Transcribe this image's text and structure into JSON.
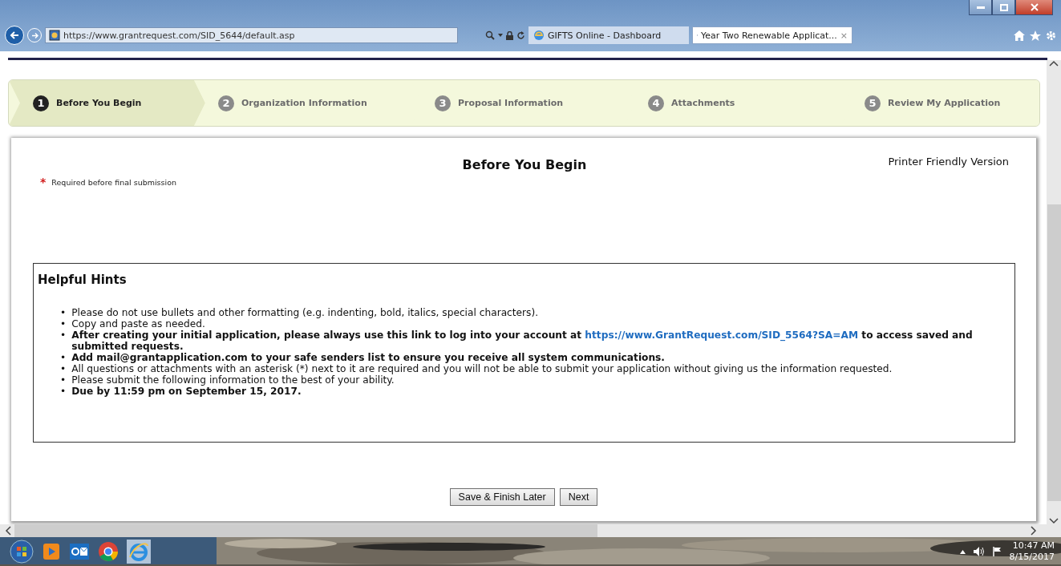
{
  "browser": {
    "address": "https://www.grantrequest.com/SID_5644/default.asp",
    "tabs": [
      {
        "label": "GIFTS Online - Dashboard",
        "selected": false
      },
      {
        "label": "Year Two Renewable Applicat...",
        "selected": true,
        "close_glyph": "×"
      }
    ]
  },
  "steps": [
    {
      "number": "1",
      "label": "Before You Begin",
      "selected": true
    },
    {
      "number": "2",
      "label": "Organization Information",
      "selected": false
    },
    {
      "number": "3",
      "label": "Proposal Information",
      "selected": false
    },
    {
      "number": "4",
      "label": "Attachments",
      "selected": false
    },
    {
      "number": "5",
      "label": "Review My Application",
      "selected": false
    }
  ],
  "page": {
    "title": "Before You Begin",
    "printer_link": "Printer Friendly Version",
    "required_mark": "*",
    "required_note": "Required before final submission"
  },
  "hints": {
    "title": "Helpful Hints",
    "bullet": "•",
    "items": [
      {
        "bold": false,
        "parts": [
          {
            "kind": "text",
            "text": "Please do not use bullets and other formatting (e.g. indenting, bold, italics, special characters)."
          }
        ]
      },
      {
        "bold": false,
        "parts": [
          {
            "kind": "text",
            "text": "Copy and paste as needed."
          }
        ]
      },
      {
        "bold": true,
        "parts": [
          {
            "kind": "text",
            "text": "After creating your initial application, please always use this link to log into your account at "
          },
          {
            "kind": "link",
            "text": "https://www.GrantRequest.com/SID_5564?SA=AM"
          },
          {
            "kind": "text",
            "text": " to access saved and submitted requests."
          }
        ]
      },
      {
        "bold": true,
        "parts": [
          {
            "kind": "text",
            "text": "Add mail@grantapplication.com to your safe senders list to ensure you receive all system communications."
          }
        ]
      },
      {
        "bold": false,
        "parts": [
          {
            "kind": "text",
            "text": "All questions or attachments with an asterisk (*) next to it are required and you will not be able to submit your application without giving us the information requested."
          }
        ]
      },
      {
        "bold": false,
        "parts": [
          {
            "kind": "text",
            "text": "Please submit the following information to the best of your ability."
          }
        ]
      },
      {
        "bold": true,
        "parts": [
          {
            "kind": "text",
            "text": "Due by 11:59 pm on September 15, 2017."
          }
        ]
      }
    ]
  },
  "buttons": [
    "Save & Finish Later",
    "Next"
  ],
  "taskbar": {
    "time": "10:47 AM",
    "date": "8/15/2017"
  }
}
